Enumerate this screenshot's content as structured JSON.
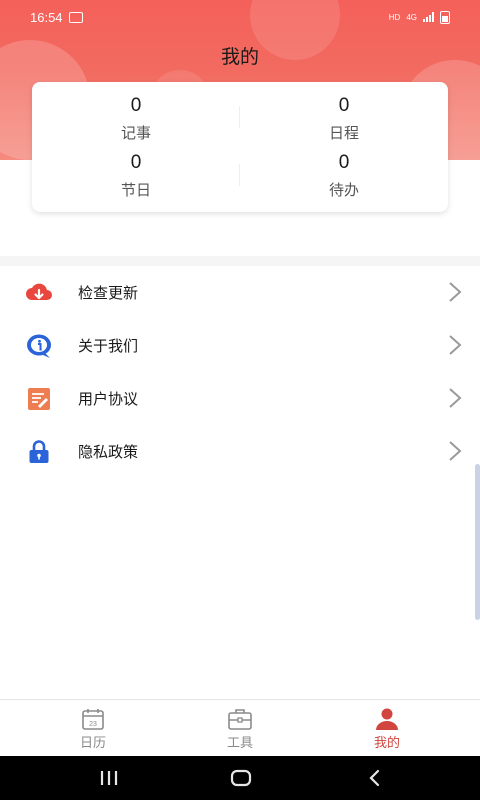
{
  "status_bar": {
    "time": "16:54",
    "hd": "HD",
    "network": "4G"
  },
  "header": {
    "title": "我的"
  },
  "stats": [
    {
      "value": "0",
      "label": "记事"
    },
    {
      "value": "0",
      "label": "日程"
    },
    {
      "value": "0",
      "label": "节日"
    },
    {
      "value": "0",
      "label": "待办"
    }
  ],
  "menu": [
    {
      "label": "检查更新",
      "icon": "cloud-download-icon"
    },
    {
      "label": "关于我们",
      "icon": "info-bubble-icon"
    },
    {
      "label": "用户协议",
      "icon": "document-edit-icon"
    },
    {
      "label": "隐私政策",
      "icon": "lock-icon"
    }
  ],
  "tabs": [
    {
      "label": "日历",
      "icon": "calendar-icon",
      "icon_text": "23",
      "active": false
    },
    {
      "label": "工具",
      "icon": "toolbox-icon",
      "active": false
    },
    {
      "label": "我的",
      "icon": "person-icon",
      "active": true
    }
  ],
  "colors": {
    "accent": "#d2453f",
    "hero": "#f4605a",
    "tab_inactive": "#8a8a8a"
  }
}
